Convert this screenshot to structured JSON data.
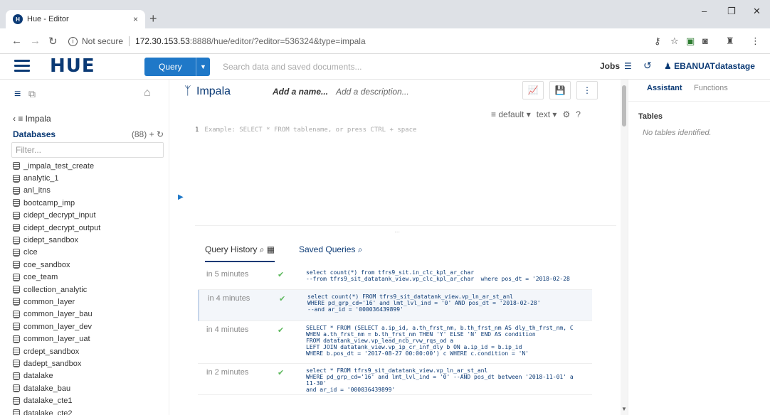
{
  "browser": {
    "tab_title": "Hue - Editor",
    "tab_close": "×",
    "new_tab": "+",
    "security_label": "Not secure",
    "url_host": "172.30.153.53",
    "url_path": ":8888/hue/editor/?editor=536324&type=impala",
    "window_min": "–",
    "window_max": "❐",
    "window_close": "✕"
  },
  "header": {
    "logo": "HUE",
    "query_button": "Query",
    "search_placeholder": "Search data and saved documents...",
    "jobs_label": "Jobs",
    "user": "EBANUATdatastage"
  },
  "left_panel": {
    "back_label": "Impala",
    "databases_title": "Databases",
    "databases_count": "(88)",
    "filter_placeholder": "Filter...",
    "databases": [
      "_impala_test_create",
      "analytic_1",
      "anl_itns",
      "bootcamp_imp",
      "cidept_decrypt_input",
      "cidept_decrypt_output",
      "cidept_sandbox",
      "clce",
      "coe_sandbox",
      "coe_team",
      "collection_analytic",
      "common_layer",
      "common_layer_bau",
      "common_layer_dev",
      "common_layer_uat",
      "crdept_sandbox",
      "dadept_sandbox",
      "datalake",
      "datalake_bau",
      "datalake_cte1",
      "datalake_cte2"
    ]
  },
  "editor": {
    "title": "Impala",
    "add_name": "Add a name...",
    "add_description": "Add a description...",
    "database_select": "default",
    "format_select": "text",
    "help": "?",
    "line_number": "1",
    "placeholder": "Example: SELECT * FROM tablename, or press CTRL + space"
  },
  "query_tabs": {
    "history": "Query History",
    "saved": "Saved Queries"
  },
  "history": [
    {
      "time": "in 5 minutes",
      "code": "select count(*) from tfrs9_sit.in_clc_kpl_ar_char\n--from tfrs9_sit_datatank_view.vp_clc_kpl_ar_char  where pos_dt = '2018-02-28"
    },
    {
      "time": "in 4 minutes",
      "code": "select count(*) FROM tfrs9_sit_datatank_view.vp_ln_ar_st_anl\nWHERE pd_grp_cd='16' and lmt_lvl_ind = '0' AND pos_dt = '2018-02-28'\n--and ar_id = '000036439899'"
    },
    {
      "time": "in 4 minutes",
      "code": "SELECT * FROM (SELECT a.ip_id, a.th_frst_nm, b.th_frst_nm AS dly_th_frst_nm, C\nWHEN a.th_frst_nm = b.th_frst_nm THEN 'Y' ELSE 'N' END AS condition\nFROM datatank_view.vp_lead_ncb_rvw_rqs_od a\nLEFT JOIN datatank_view.vp_ip_cr_inf_dly b ON a.ip_id = b.ip_id\nWHERE b.pos_dt = '2017-08-27 00:00:00') c WHERE c.condition = 'N'"
    },
    {
      "time": "in 2 minutes",
      "code": "select * FROM tfrs9_sit_datatank_view.vp_ln_ar_st_anl\nWHERE pd_grp_cd='16' and lmt_lvl_ind = '0' --AND pos_dt between '2018-11-01' a\n11-30'\nand ar_id = '000036439899'"
    }
  ],
  "assistant": {
    "tab_assistant": "Assistant",
    "tab_functions": "Functions",
    "tables_heading": "Tables",
    "no_tables": "No tables identified."
  },
  "colors": {
    "brand": "#0b3a75",
    "primary_button": "#1f78c8",
    "success": "#5cb85c"
  }
}
